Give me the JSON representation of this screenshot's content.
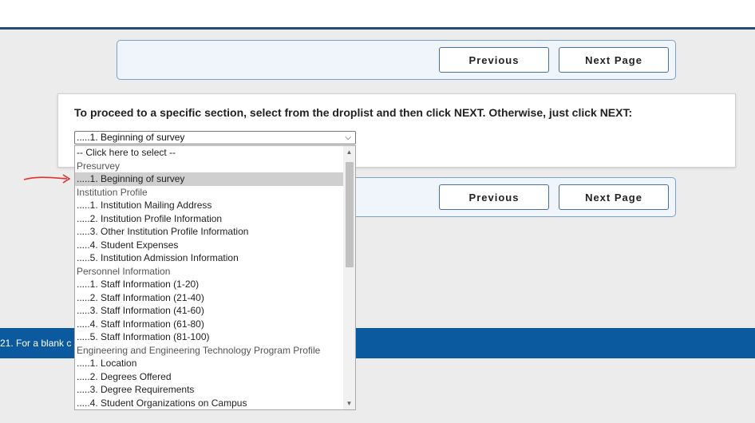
{
  "nav": {
    "previous_label": "Previous",
    "next_label": "Next Page"
  },
  "section_select": {
    "instruction": "To proceed to a specific section, select from the droplist and then click NEXT. Otherwise, just click NEXT:",
    "selected_value": ".....1. Beginning of survey"
  },
  "dropdown_options": [
    {
      "label": "-- Click here to select --",
      "type": "option"
    },
    {
      "label": "Presurvey",
      "type": "group"
    },
    {
      "label": ".....1. Beginning of survey",
      "type": "option",
      "selected": true
    },
    {
      "label": "Institution Profile",
      "type": "group"
    },
    {
      "label": ".....1. Institution Mailing Address",
      "type": "option"
    },
    {
      "label": ".....2. Institution Profile Information",
      "type": "option"
    },
    {
      "label": ".....3. Other Institution Profile Information",
      "type": "option"
    },
    {
      "label": ".....4. Student Expenses",
      "type": "option"
    },
    {
      "label": ".....5. Institution Admission Information",
      "type": "option"
    },
    {
      "label": "Personnel Information",
      "type": "group"
    },
    {
      "label": ".....1. Staff Information (1-20)",
      "type": "option"
    },
    {
      "label": ".....2. Staff Information (21-40)",
      "type": "option"
    },
    {
      "label": ".....3. Staff Information (41-60)",
      "type": "option"
    },
    {
      "label": ".....4. Staff Information (61-80)",
      "type": "option"
    },
    {
      "label": ".....5. Staff Information (81-100)",
      "type": "option"
    },
    {
      "label": "Engineering and Engineering Technology Program Profile",
      "type": "group"
    },
    {
      "label": ".....1. Location",
      "type": "option"
    },
    {
      "label": ".....2. Degrees Offered",
      "type": "option"
    },
    {
      "label": ".....3. Degree Requirements",
      "type": "option"
    },
    {
      "label": ".....4. Student Organizations on Campus",
      "type": "option"
    }
  ],
  "footer": {
    "text": "21. For a blank c"
  },
  "colors": {
    "footer_band": "#0b5aa0",
    "annotation_arrow": "#e53030",
    "selected_option": "#cfcfcf"
  }
}
